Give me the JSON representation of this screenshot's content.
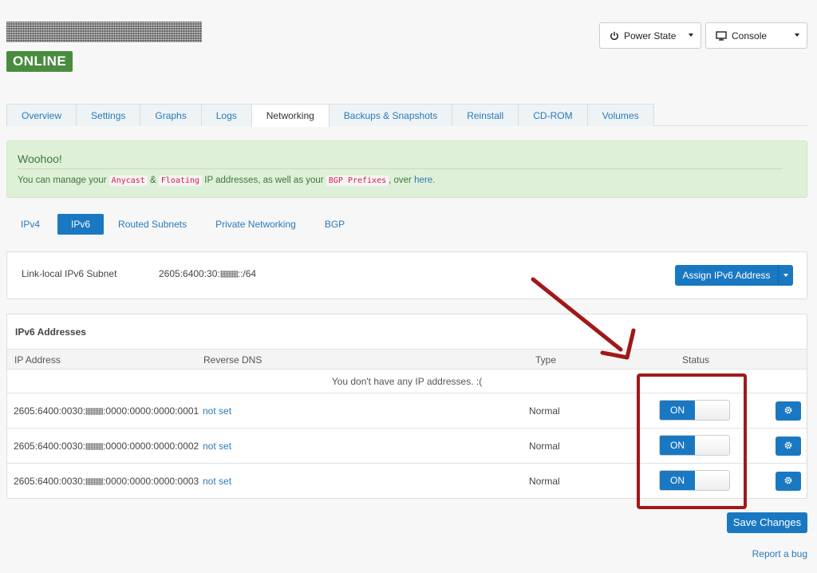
{
  "header": {
    "status_badge": "ONLINE",
    "power_state_label": "Power State",
    "console_label": "Console"
  },
  "tabs": [
    {
      "label": "Overview"
    },
    {
      "label": "Settings"
    },
    {
      "label": "Graphs"
    },
    {
      "label": "Logs"
    },
    {
      "label": "Networking",
      "active": true
    },
    {
      "label": "Backups & Snapshots"
    },
    {
      "label": "Reinstall"
    },
    {
      "label": "CD-ROM"
    },
    {
      "label": "Volumes"
    }
  ],
  "alert": {
    "title": "Woohoo!",
    "text_1": "You can manage your",
    "code_1": "Anycast",
    "text_2": "&",
    "code_2": "Floating",
    "text_3": "IP addresses, as well as your",
    "code_3": "BGP Prefixes",
    "text_4": ", over",
    "link": "here",
    "text_5": "."
  },
  "subtabs": [
    {
      "label": "IPv4"
    },
    {
      "label": "IPv6",
      "active": true
    },
    {
      "label": "Routed Subnets"
    },
    {
      "label": "Private Networking"
    },
    {
      "label": "BGP"
    }
  ],
  "subnet": {
    "label": "Link-local IPv6 Subnet",
    "value_prefix": "2605:6400:30:",
    "value_suffix": "::/64",
    "assign_button": "Assign IPv6 Address"
  },
  "ipv6": {
    "title": "IPv6 Addresses",
    "columns": {
      "ip": "IP Address",
      "rdns": "Reverse DNS",
      "type": "Type",
      "status": "Status"
    },
    "empty_message": "You don't have any IP addresses. :(",
    "rows": [
      {
        "ip_prefix": "2605:6400:0030:",
        "ip_suffix": ":0000:0000:0000:0001",
        "rdns": "not set",
        "type": "Normal",
        "status": "ON"
      },
      {
        "ip_prefix": "2605:6400:0030:",
        "ip_suffix": ":0000:0000:0000:0002",
        "rdns": "not set",
        "type": "Normal",
        "status": "ON"
      },
      {
        "ip_prefix": "2605:6400:0030:",
        "ip_suffix": ":0000:0000:0000:0003",
        "rdns": "not set",
        "type": "Normal",
        "status": "ON"
      }
    ]
  },
  "footer": {
    "save_button": "Save Changes",
    "report_link": "Report a bug"
  },
  "colors": {
    "primary": "#1a78c2",
    "success": "#4a8c3f",
    "annotation": "#a01818"
  },
  "icons": [
    "power-icon",
    "monitor-icon",
    "gear-icon"
  ]
}
